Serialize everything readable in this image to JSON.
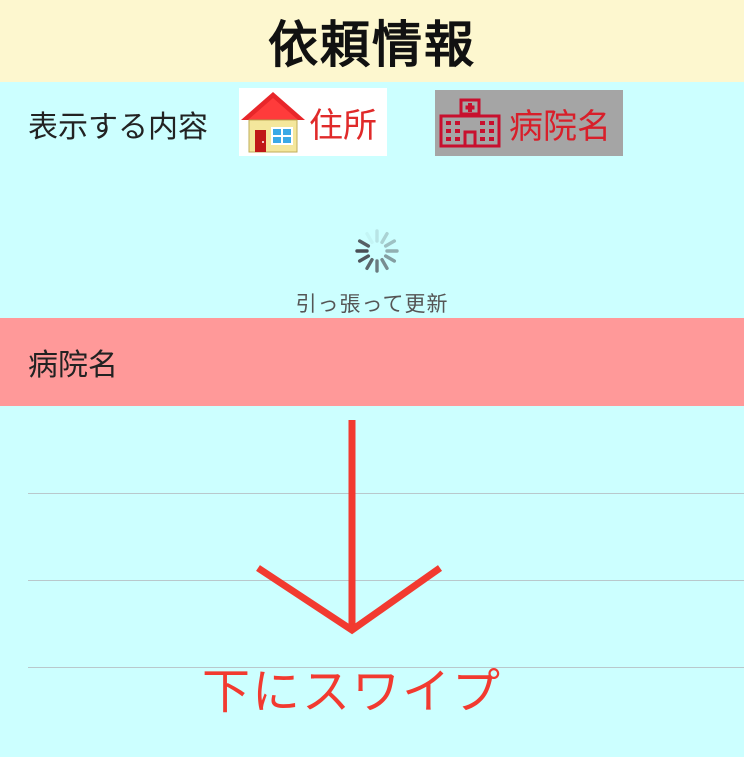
{
  "header": {
    "title": "依頼情報"
  },
  "filter": {
    "label": "表示する内容",
    "address_label": "住所",
    "hospital_label": "病院名"
  },
  "refresh": {
    "text": "引っ張って更新"
  },
  "list": {
    "section_title": "病院名"
  },
  "hint": {
    "text": "下にスワイプ"
  },
  "colors": {
    "header_bg": "#fdf7cf",
    "page_bg": "#ccffff",
    "section_bg": "#ff9999",
    "accent_red": "#f23a30"
  }
}
